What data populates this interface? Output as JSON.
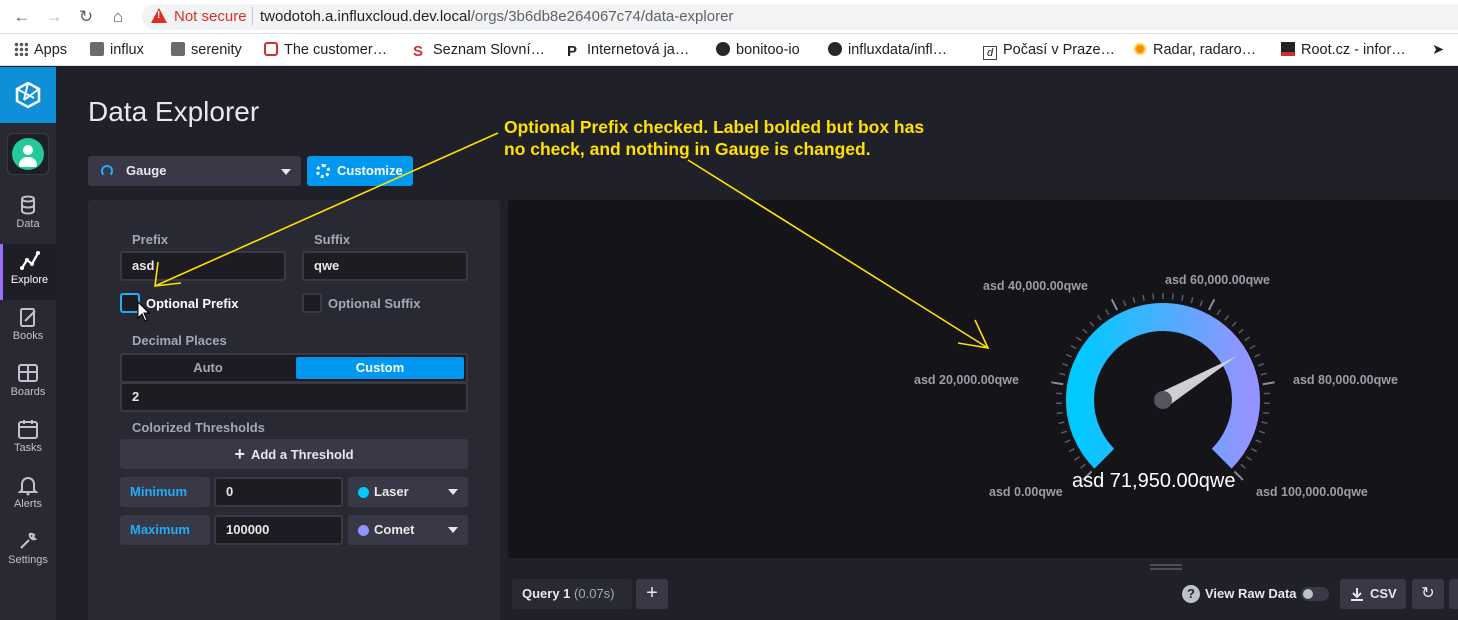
{
  "browser": {
    "security_label": "Not secure",
    "url_host": "twodotoh.a.influxcloud.dev.local",
    "url_path": "/orgs/3b6db8e264067c74/data-explorer",
    "bookmarks": [
      {
        "label": "Apps",
        "icon": "apps-grid-icon"
      },
      {
        "label": "influx",
        "icon": "folder-icon"
      },
      {
        "label": "serenity",
        "icon": "folder-icon"
      },
      {
        "label": "The customer…",
        "icon": "bookmark-red-icon"
      },
      {
        "label": "Seznam Slovní…",
        "icon": "seznam-icon"
      },
      {
        "label": "Internetová ja…",
        "icon": "p-icon"
      },
      {
        "label": "bonitoo-io",
        "icon": "github-icon"
      },
      {
        "label": "influxdata/infl…",
        "icon": "github-icon"
      },
      {
        "label": "Počasí v Praze…",
        "icon": "weather-icon"
      },
      {
        "label": "Radar, radaro…",
        "icon": "sun-icon"
      },
      {
        "label": "Root.cz - infor…",
        "icon": "root-icon"
      }
    ]
  },
  "nav": {
    "items": [
      {
        "label": "Data",
        "icon": "database-icon"
      },
      {
        "label": "Explore",
        "icon": "graph-icon",
        "active": true
      },
      {
        "label": "Books",
        "icon": "notebook-icon"
      },
      {
        "label": "Boards",
        "icon": "dashboard-icon"
      },
      {
        "label": "Tasks",
        "icon": "calendar-icon"
      },
      {
        "label": "Alerts",
        "icon": "bell-icon"
      },
      {
        "label": "Settings",
        "icon": "wrench-icon"
      }
    ]
  },
  "page": {
    "title": "Data Explorer",
    "viz_type": "Gauge",
    "customize_label": "Customize"
  },
  "options": {
    "prefix_label": "Prefix",
    "prefix_value": "asd",
    "suffix_label": "Suffix",
    "suffix_value": "qwe",
    "optional_prefix_label": "Optional Prefix",
    "optional_suffix_label": "Optional Suffix",
    "optional_prefix_checked": false,
    "optional_suffix_checked": false,
    "decimal_places_label": "Decimal Places",
    "decimal_auto": "Auto",
    "decimal_custom": "Custom",
    "decimal_selected": "Custom",
    "decimal_value": "2",
    "thresholds_label": "Colorized Thresholds",
    "add_threshold_label": "Add a Threshold",
    "minimum_label": "Minimum",
    "minimum_value": "0",
    "minimum_color_name": "Laser",
    "minimum_color": "#00c9ff",
    "maximum_label": "Maximum",
    "maximum_value": "100000",
    "maximum_color_name": "Comet",
    "maximum_color": "#9394ff"
  },
  "gauge": {
    "min": 0,
    "max": 100000,
    "value": 71950,
    "value_label": "asd 71,950.00qwe",
    "tick_labels": [
      "asd 0.00qwe",
      "asd 20,000.00qwe",
      "asd 40,000.00qwe",
      "asd 60,000.00qwe",
      "asd 80,000.00qwe",
      "asd 100,000.00qwe"
    ],
    "start_color": "#00c9ff",
    "end_color": "#9394ff"
  },
  "query_bar": {
    "tab_label": "Query 1",
    "tab_time": "(0.07s)",
    "add_label": "+",
    "view_raw_label": "View Raw Data",
    "csv_label": "CSV"
  },
  "annotation": {
    "line1": "Optional Prefix checked.  Label bolded but box has",
    "line2": "no check, and nothing in Gauge is changed."
  }
}
